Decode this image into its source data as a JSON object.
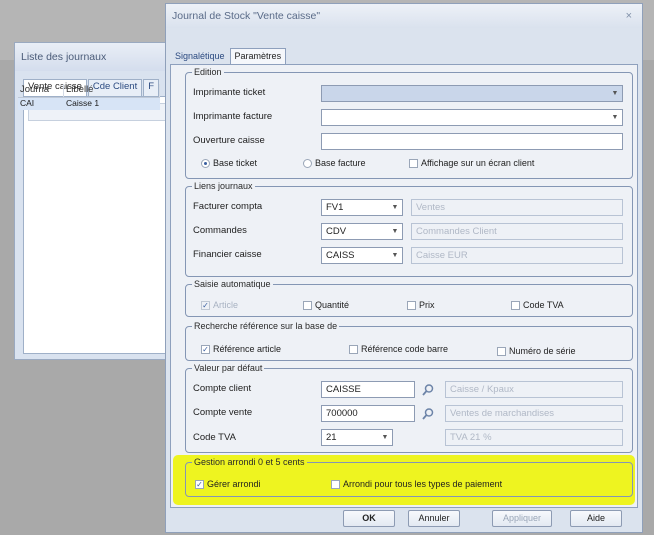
{
  "back_window": {
    "title": "Liste des journaux",
    "tabs": [
      "Vente caisse",
      "Cde Client",
      "F"
    ],
    "grid_headers": [
      "Journa",
      "Libellé"
    ],
    "grid_row": [
      "CAI",
      "Caisse 1"
    ]
  },
  "dialog": {
    "title": "Journal de Stock \"Vente caisse\"",
    "close": "×",
    "tabs": [
      "Signalétique",
      "Paramètres"
    ]
  },
  "edition": {
    "legend": "Edition",
    "printer_ticket_label": "Imprimante ticket",
    "printer_invoice_label": "Imprimante facture",
    "opening_label": "Ouverture caisse",
    "opt_ticket": "Base ticket",
    "opt_invoice": "Base facture",
    "opt_screen": "Affichage sur un écran client"
  },
  "liens": {
    "legend": "Liens journaux",
    "rows": [
      {
        "label": "Facturer compta",
        "code": "FV1",
        "desc": "Ventes"
      },
      {
        "label": "Commandes",
        "code": "CDV",
        "desc": "Commandes Client"
      },
      {
        "label": "Financier caisse",
        "code": "CAISS",
        "desc": "Caisse EUR"
      }
    ]
  },
  "saisie": {
    "legend": "Saisie automatique",
    "items": [
      "Article",
      "Quantité",
      "Prix",
      "Code TVA"
    ]
  },
  "recherche": {
    "legend": "Recherche référence sur la base de",
    "items": [
      "Référence article",
      "Référence code barre",
      "Numéro de série"
    ]
  },
  "defaut": {
    "legend": "Valeur par défaut",
    "client_label": "Compte client",
    "client_value": "CAISSE",
    "client_desc": "Caisse / Kpaux",
    "vente_label": "Compte vente",
    "vente_value": "700000",
    "vente_desc": "Ventes de marchandises",
    "tva_label": "Code TVA",
    "tva_value": "21",
    "tva_desc": "TVA 21 %"
  },
  "arrondi": {
    "legend": "Gestion arrondi 0 et 5 cents",
    "opt_gerer": "Gérer arrondi",
    "opt_all": "Arrondi pour tous les types de paiement"
  },
  "buttons": {
    "ok": "OK",
    "cancel": "Annuler",
    "apply": "Appliquer",
    "help": "Aide"
  },
  "colors": {
    "highlight": "#eef420",
    "selected_field": "#c9d6ea"
  }
}
